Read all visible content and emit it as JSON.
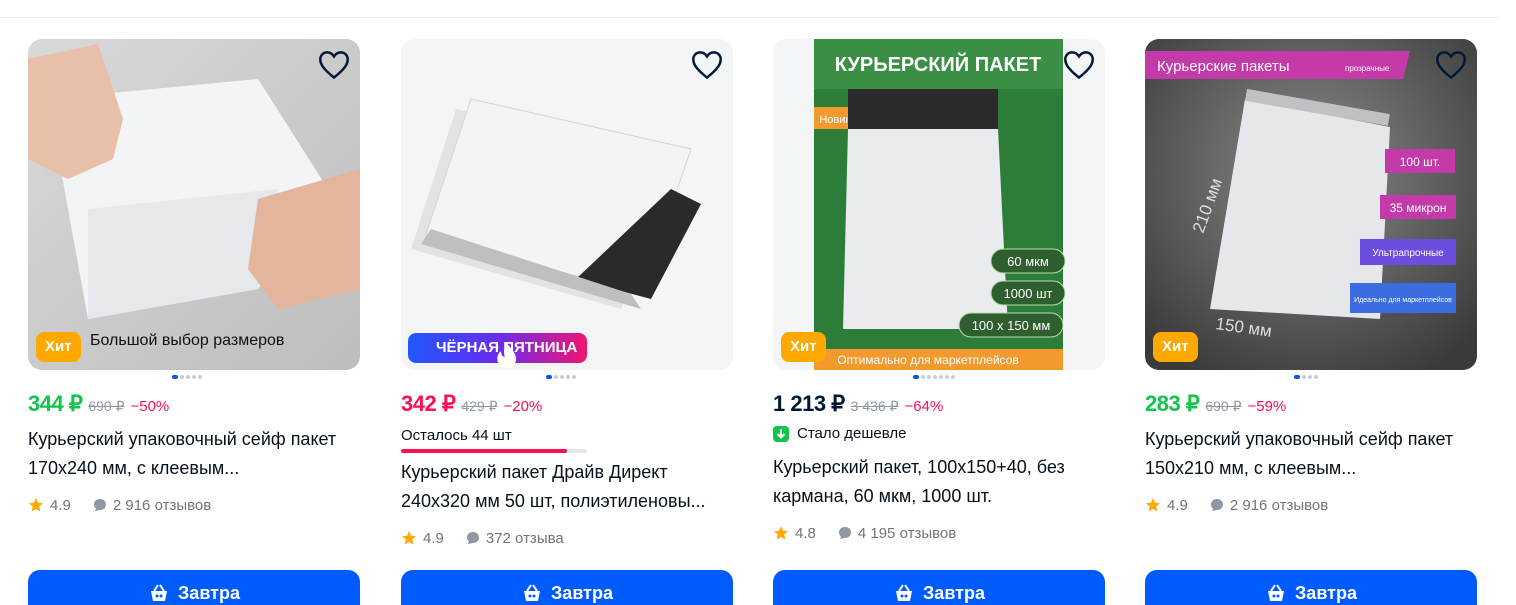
{
  "colors": {
    "accent": "#005bff",
    "price_green": "#10c44c",
    "price_red": "#f91155",
    "hit_badge": "#ffa800"
  },
  "products": [
    {
      "badge": "Хит",
      "badge_caption": "Большой выбор размеров",
      "price": "344 ₽",
      "old_price": "690 ₽",
      "discount": "−50%",
      "title": "Курьерский упаковочный сейф пакет 170x240 мм, с клеевым...",
      "rating": "4.9",
      "reviews": "2 916 отзывов",
      "cart_label": "Завтра",
      "gallery": {
        "active": 1,
        "count": 5
      }
    },
    {
      "badge": "ЧЁРНАЯ ПЯТНИЦА",
      "price": "342 ₽",
      "old_price": "429 ₽",
      "discount": "−20%",
      "stock_text": "Осталось 44 шт",
      "stock_level": 0.89,
      "title": "Курьерский пакет Драйв Директ 240x320 мм 50 шт, полиэтиленовы...",
      "rating": "4.9",
      "reviews": "372 отзыва",
      "cart_label": "Завтра",
      "gallery": {
        "active": 1,
        "count": 5
      }
    },
    {
      "badge": "Хит",
      "image_text": {
        "header": "КУРЬЕРСКИЙ ПАКЕТ",
        "new_tag": "Новинка",
        "spec1": "60 мкм",
        "spec2": "1000 шт",
        "spec3": "100 х 150 мм",
        "footer": "Оптимально для маркетплейсов"
      },
      "price": "1 213 ₽",
      "old_price": "3 436 ₽",
      "discount": "−64%",
      "cheaper_text": "Стало дешевле",
      "title": "Курьерский пакет, 100x150+40, без кармана, 60 мкм, 1000 шт.",
      "rating": "4.8",
      "reviews": "4 195 отзывов",
      "cart_label": "Завтра",
      "gallery": {
        "active": 1,
        "count": 7
      }
    },
    {
      "badge": "Хит",
      "image_text": {
        "header": "Курьерские пакеты",
        "header_small": "прозрачные",
        "dim_v": "210 мм",
        "dim_h": "150 мм",
        "tag1": "100 шт.",
        "tag2": "35 микрон",
        "tag3": "Ультрапрочные",
        "tag4": "Идеально для маркетплейсов"
      },
      "price": "283 ₽",
      "old_price": "690 ₽",
      "discount": "−59%",
      "title": "Курьерский упаковочный сейф пакет 150x210 мм, с клеевым...",
      "rating": "4.9",
      "reviews": "2 916 отзывов",
      "cart_label": "Завтра",
      "gallery": {
        "active": 1,
        "count": 4
      }
    }
  ]
}
